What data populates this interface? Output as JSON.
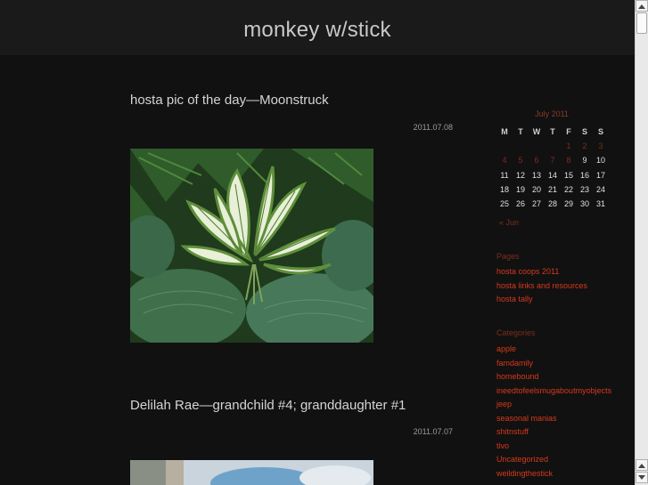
{
  "site": {
    "title": "monkey w/stick"
  },
  "posts": [
    {
      "title": "hosta pic of the day—Moonstruck",
      "date": "2011.07.08"
    },
    {
      "title": "Delilah Rae—grandchild #4; granddaughter #1",
      "date": "2011.07.07"
    }
  ],
  "calendar": {
    "caption": "July 2011",
    "weekdays": [
      "M",
      "T",
      "W",
      "T",
      "F",
      "S",
      "S"
    ],
    "weeks": [
      [
        "",
        "",
        "",
        "",
        "1",
        "2",
        "3"
      ],
      [
        "4",
        "5",
        "6",
        "7",
        "8",
        "9",
        "10"
      ],
      [
        "11",
        "12",
        "13",
        "14",
        "15",
        "16",
        "17"
      ],
      [
        "18",
        "19",
        "20",
        "21",
        "22",
        "23",
        "24"
      ],
      [
        "25",
        "26",
        "27",
        "28",
        "29",
        "30",
        "31"
      ]
    ],
    "prev_link": "« Jun"
  },
  "pages_widget": {
    "title": "Pages",
    "items": [
      "hosta coops 2011",
      "hosta links and resources",
      "hosta tally"
    ]
  },
  "categories_widget": {
    "title": "Categories",
    "items": [
      "apple",
      "famdamily",
      "homebound",
      "ineedtofeelsmugaboutmyobjects",
      "jeep",
      "seasonal manias",
      "shitnstuff",
      "tivo",
      "Uncategorized",
      "weildingthestick"
    ]
  },
  "colors": {
    "background": "#111111",
    "header": "#1a1a1a",
    "link": "#d6391c",
    "muted_link": "#7a2e1c"
  }
}
